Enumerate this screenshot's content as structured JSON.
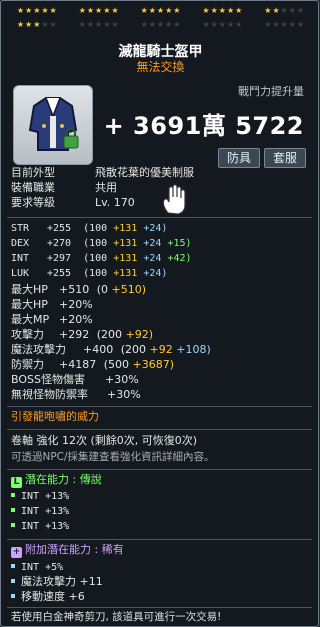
{
  "stars": {
    "row1_filled": 22,
    "row2_filled": 3,
    "total_per_row": 25
  },
  "item": {
    "name": "滅龍騎士盔甲",
    "trade_status": "無法交換"
  },
  "combat": {
    "label": "戰鬥力提升量",
    "value": "+ 3691萬 5722"
  },
  "buttons": {
    "armor": "防具",
    "set": "套服"
  },
  "info": [
    {
      "label": "目前外型",
      "value": "飛散花葉的優美制服"
    },
    {
      "label": "裝備職業",
      "value": "共用"
    },
    {
      "label": "要求等級",
      "value": "Lv. 170"
    }
  ],
  "stats": [
    {
      "name": "STR",
      "total": "+255",
      "open": "(100",
      "star": "+131",
      "flame": "+24)",
      "extra": ""
    },
    {
      "name": "DEX",
      "total": "+270",
      "open": "(100",
      "star": "+131",
      "flame": "+24",
      "extra": "+15)"
    },
    {
      "name": "INT",
      "total": "+297",
      "open": "(100",
      "star": "+131",
      "flame": "+24",
      "extra": "+42)"
    },
    {
      "name": "LUK",
      "total": "+255",
      "open": "(100",
      "star": "+131",
      "flame": "+24)",
      "extra": ""
    }
  ],
  "other_stats": {
    "hp_label": "最大HP",
    "hp_value": "+510",
    "hp_detail_open": "(0",
    "hp_detail_star": "+510)",
    "hp_pct_label": "最大HP",
    "hp_pct_value": "+20%",
    "mp_pct_label": "最大MP",
    "mp_pct_value": "+20%",
    "atk_label": "攻擊力",
    "atk_value": "+292",
    "atk_open": "(200",
    "atk_star": "+92)",
    "matk_label": "魔法攻擊力",
    "matk_value": "+400",
    "matk_open": "(200",
    "matk_star": "+92",
    "matk_flame": "+108)",
    "def_label": "防禦力",
    "def_value": "+4187",
    "def_open": "(500",
    "def_star": "+3687)",
    "boss_label": "BOSS怪物傷害",
    "boss_value": "+30%",
    "ied_label": "無視怪物防禦率",
    "ied_value": "+30%"
  },
  "set_effect": "引發龍咆嘯的威力",
  "scroll": {
    "label": "卷軸 強化 12次",
    "detail": "(剩餘0次, 可恢復0次)"
  },
  "npc_hint": "可透過NPC/採集建查看強化資訊詳細內容。",
  "potential": {
    "title": "潛在能力 : 傳說",
    "badge": "L",
    "lines": [
      "INT +13%",
      "INT +13%",
      "INT +13%"
    ]
  },
  "additional": {
    "title": "附加潛在能力 : 稀有",
    "badge": "+",
    "lines": [
      "INT +5%",
      "魔法攻擊力 +11",
      "移動速度 +6"
    ]
  },
  "footer": "若使用白金神奇剪刀, 該道具可進行一次交易!",
  "colors": {
    "gold": "#ffcc33",
    "flame": "#9ad7ff",
    "extra": "#7dff6b",
    "legend": "#7dff6b",
    "rare": "#caa2ff"
  }
}
